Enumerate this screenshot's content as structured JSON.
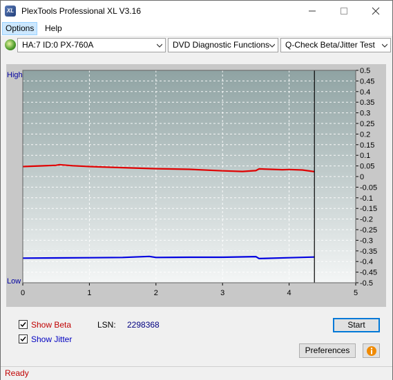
{
  "window": {
    "title": "PlexTools Professional XL V3.16",
    "icon_label": "XL",
    "minimize_icon": "minimize-icon",
    "maximize_icon": "maximize-icon",
    "close_icon": "close-icon"
  },
  "menu": {
    "items": [
      {
        "label": "Options"
      },
      {
        "label": "Help"
      }
    ]
  },
  "toolbar": {
    "drive": "HA:7 ID:0  PX-760A",
    "function": "DVD Diagnostic Functions",
    "test": "Q-Check Beta/Jitter Test"
  },
  "chart": {
    "y_high_label": "High",
    "y_low_label": "Low",
    "colors": {
      "background_top": "#8fa3a3",
      "background_bottom": "#f4f6f6",
      "beta": "#e00000",
      "jitter": "#0000e0",
      "grid": "#ffffff",
      "position_marker": "#000000"
    }
  },
  "chart_data": {
    "type": "line",
    "xlim": [
      0,
      5
    ],
    "ylim": [
      -0.5,
      0.5
    ],
    "x_ticks": [
      "0",
      "1",
      "2",
      "3",
      "4",
      "5"
    ],
    "y_ticks": [
      "0.5",
      "0.45",
      "0.4",
      "0.35",
      "0.3",
      "0.25",
      "0.2",
      "0.15",
      "0.1",
      "0.05",
      "0",
      "-0.05",
      "-0.1",
      "-0.15",
      "-0.2",
      "-0.25",
      "-0.3",
      "-0.35",
      "-0.4",
      "-0.45",
      "-0.5"
    ],
    "marker_x": 4.38,
    "series": [
      {
        "name": "Beta",
        "x": [
          0,
          0.25,
          0.5,
          0.55,
          0.75,
          1.0,
          1.5,
          2.0,
          2.5,
          3.0,
          3.3,
          3.5,
          3.55,
          3.9,
          4.0,
          4.2,
          4.38
        ],
        "values": [
          0.047,
          0.05,
          0.053,
          0.056,
          0.051,
          0.047,
          0.042,
          0.037,
          0.034,
          0.027,
          0.024,
          0.028,
          0.036,
          0.032,
          0.033,
          0.031,
          0.023
        ]
      },
      {
        "name": "Jitter",
        "x": [
          0,
          0.5,
          1.0,
          1.5,
          1.9,
          2.0,
          2.5,
          3.0,
          3.5,
          3.55,
          4.0,
          4.38
        ],
        "values": [
          -0.384,
          -0.383,
          -0.382,
          -0.381,
          -0.376,
          -0.381,
          -0.38,
          -0.38,
          -0.377,
          -0.386,
          -0.382,
          -0.379
        ]
      }
    ]
  },
  "options": {
    "show_beta": {
      "label": "Show Beta",
      "checked": true,
      "color": "#c00000"
    },
    "show_jitter": {
      "label": "Show Jitter",
      "checked": true,
      "color": "#0000c0"
    }
  },
  "lsn": {
    "label": "LSN:",
    "value": "2298368"
  },
  "buttons": {
    "start": "Start",
    "preferences": "Preferences",
    "info_icon": "info-icon"
  },
  "status": {
    "text": "Ready"
  }
}
